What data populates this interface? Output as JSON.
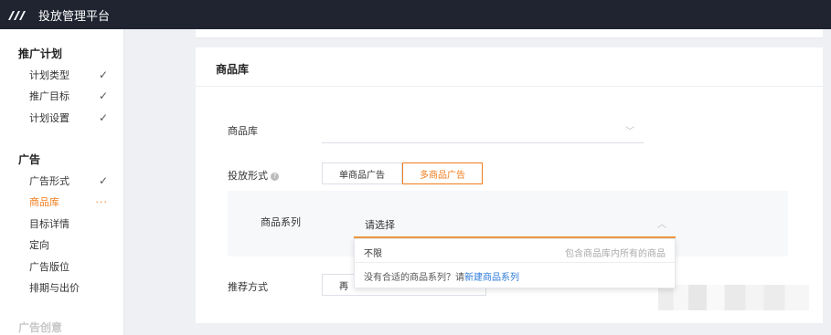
{
  "app": {
    "title": "投放管理平台"
  },
  "sidebar": {
    "groups": [
      {
        "label": "推广计划",
        "items": [
          {
            "label": "计划类型"
          },
          {
            "label": "推广目标"
          },
          {
            "label": "计划设置"
          }
        ]
      },
      {
        "label": "广告",
        "items": [
          {
            "label": "广告形式"
          },
          {
            "label": "商品库"
          },
          {
            "label": "目标详情"
          },
          {
            "label": "定向"
          },
          {
            "label": "广告版位"
          },
          {
            "label": "排期与出价"
          }
        ]
      },
      {
        "label": "广告创意",
        "items": []
      }
    ],
    "check_mark": "✓",
    "active_marker": "···"
  },
  "card": {
    "title": "商品库",
    "library_label": "商品库",
    "delivery_label": "投放形式",
    "help_icon": "?",
    "segment": {
      "single": "单商品广告",
      "multi": "多商品广告",
      "selected": "多商品广告"
    },
    "series_label": "商品系列",
    "series_placeholder": "请选择",
    "recommend_label": "推荐方式",
    "recommend_button": "再"
  },
  "dropdown": {
    "option_label": "不限",
    "option_desc": "包含商品库内所有的商品",
    "footer_text": "没有合适的商品系列？请",
    "footer_link": "新建商品系列"
  },
  "colors": {
    "accent": "#f07d1e",
    "link": "#2d7bd8",
    "topbar": "#1f2430"
  }
}
